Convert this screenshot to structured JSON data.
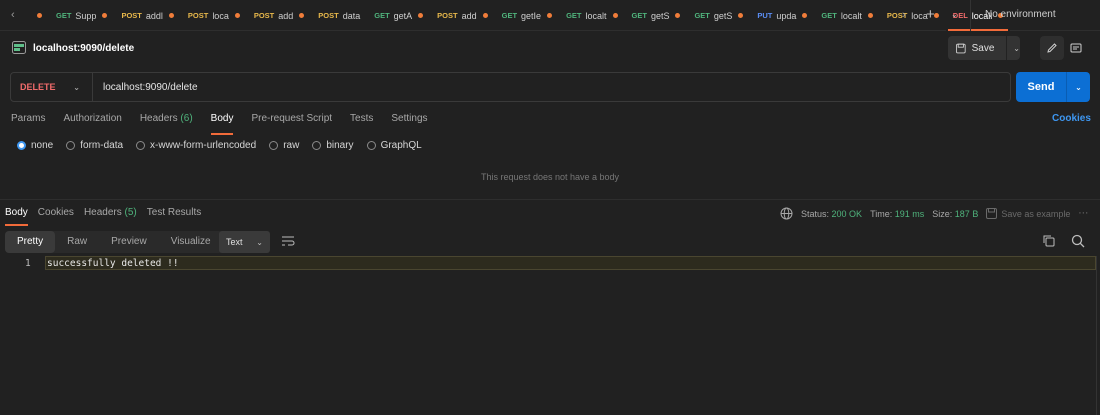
{
  "tabs": [
    {
      "method": "",
      "name": "",
      "dot": true
    },
    {
      "method": "GET",
      "name": "Supp",
      "dot": true
    },
    {
      "method": "POST",
      "name": "addl",
      "dot": true
    },
    {
      "method": "POST",
      "name": "loca",
      "dot": true
    },
    {
      "method": "POST",
      "name": "add",
      "dot": true
    },
    {
      "method": "POST",
      "name": "data",
      "dot": false
    },
    {
      "method": "GET",
      "name": "getA",
      "dot": true
    },
    {
      "method": "POST",
      "name": "add",
      "dot": true
    },
    {
      "method": "GET",
      "name": "getIe",
      "dot": true
    },
    {
      "method": "GET",
      "name": "localt",
      "dot": true
    },
    {
      "method": "GET",
      "name": "getS",
      "dot": true
    },
    {
      "method": "GET",
      "name": "getS",
      "dot": true
    },
    {
      "method": "PUT",
      "name": "upda",
      "dot": true
    },
    {
      "method": "GET",
      "name": "localt",
      "dot": true
    },
    {
      "method": "POST",
      "name": "loca",
      "dot": true
    },
    {
      "method": "DEL",
      "name": "locall",
      "dot": true,
      "active": true
    }
  ],
  "environment": "No environment",
  "request": {
    "title": "localhost:9090/delete",
    "method": "DELETE",
    "url": "localhost:9090/delete",
    "save_label": "Save",
    "send_label": "Send"
  },
  "request_tabs": {
    "params": "Params",
    "authorization": "Authorization",
    "headers": "Headers",
    "headers_count": "(6)",
    "body": "Body",
    "prerequest": "Pre-request Script",
    "tests": "Tests",
    "settings": "Settings",
    "cookies": "Cookies"
  },
  "body_types": [
    "none",
    "form-data",
    "x-www-form-urlencoded",
    "raw",
    "binary",
    "GraphQL"
  ],
  "body_selected": "none",
  "empty_body_text": "This request does not have a body",
  "response": {
    "tabs": {
      "body": "Body",
      "cookies": "Cookies",
      "headers": "Headers",
      "headers_count": "(5)",
      "test_results": "Test Results"
    },
    "status_label": "Status:",
    "status_value": "200 OK",
    "time_label": "Time:",
    "time_value": "191 ms",
    "size_label": "Size:",
    "size_value": "187 B",
    "save_example": "Save as example",
    "view_tabs": [
      "Pretty",
      "Raw",
      "Preview",
      "Visualize"
    ],
    "format": "Text",
    "lines": [
      {
        "no": "1",
        "text": "successfully deleted !!"
      }
    ]
  },
  "colors": {
    "accent": "#f26b3a",
    "send": "#0c6fd4",
    "success": "#4fb37c",
    "delete": "#f26b6b"
  }
}
